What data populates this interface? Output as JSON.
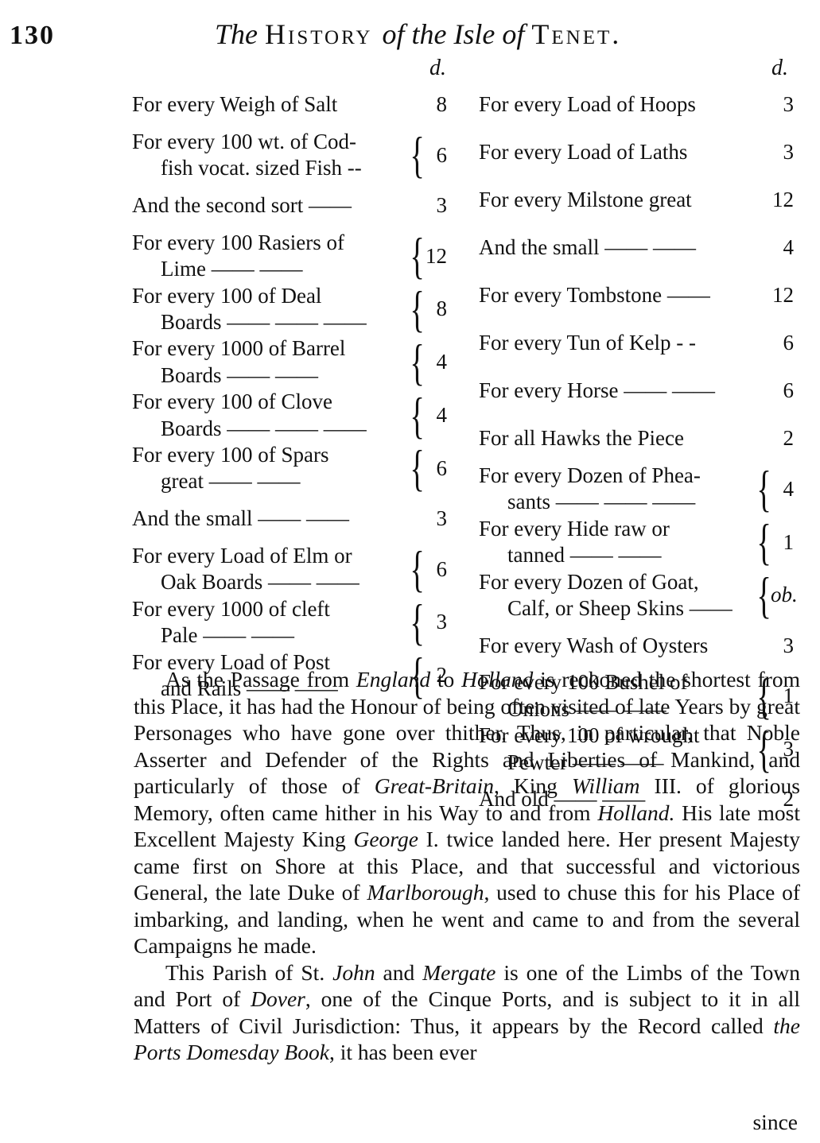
{
  "header": {
    "page_number": "130",
    "title_parts": [
      {
        "text": "The ",
        "style": "it"
      },
      {
        "text": "History ",
        "style": "sc"
      },
      {
        "text": "of the Isle of ",
        "style": "it"
      },
      {
        "text": "Tenet.",
        "style": "sc"
      }
    ]
  },
  "table": {
    "column_unit": "d.",
    "left": [
      {
        "lines": [
          "For every Weigh of Salt"
        ],
        "value": "8"
      },
      {
        "lines": [
          "For every 100 wt. of Cod-",
          "fish vocat. sized Fish --"
        ],
        "value": "6"
      },
      {
        "lines": [
          "And the second sort ——"
        ],
        "value": "3"
      },
      {
        "lines": [
          "For every 100 Rasiers of",
          "Lime —— ——"
        ],
        "value": "12"
      },
      {
        "lines": [
          "For every 100 of Deal",
          "Boards —— —— ——"
        ],
        "value": "8"
      },
      {
        "lines": [
          "For every 1000 of Barrel",
          "Boards —— ——"
        ],
        "value": "4"
      },
      {
        "lines": [
          "For every 100 of Clove",
          "Boards —— —— ——"
        ],
        "value": "4"
      },
      {
        "lines": [
          "For every 100 of Spars",
          "great —— ——"
        ],
        "value": "6"
      },
      {
        "lines": [
          "And the small —— ——"
        ],
        "value": "3"
      },
      {
        "lines": [
          "For every Load of Elm or",
          "Oak Boards —— ——"
        ],
        "value": "6"
      },
      {
        "lines": [
          "For every 1000 of cleft",
          "Pale —— ——"
        ],
        "value": "3"
      },
      {
        "lines": [
          "For every Load of Post",
          "and Rails —— ——"
        ],
        "value": "2"
      }
    ],
    "right": [
      {
        "lines": [
          "For every Load of Hoops"
        ],
        "value": "3"
      },
      {
        "lines": [
          "For every Load of Laths"
        ],
        "value": "3"
      },
      {
        "lines": [
          "For every Milstone great"
        ],
        "value": "12"
      },
      {
        "lines": [
          "And the small —— ——"
        ],
        "value": "4"
      },
      {
        "lines": [
          "For every Tombstone ——"
        ],
        "value": "12"
      },
      {
        "lines": [
          "For every Tun of Kelp - -"
        ],
        "value": "6"
      },
      {
        "lines": [
          "For every Horse —— ——"
        ],
        "value": "6"
      },
      {
        "lines": [
          "For all Hawks the Piece"
        ],
        "value": "2"
      },
      {
        "lines": [
          "For every Dozen of Phea-",
          "sants —— —— ——"
        ],
        "value": "4"
      },
      {
        "lines": [
          "For every Hide raw or",
          "tanned —— ——"
        ],
        "value": "1"
      },
      {
        "lines": [
          "For every Dozen of Goat,",
          "Calf, or Sheep Skins ——"
        ],
        "value": "ob."
      },
      {
        "lines": [
          "For every Wash of Oysters"
        ],
        "value": "3"
      },
      {
        "lines": [
          "For every 100 Bushel of",
          "Onions —— ——"
        ],
        "value": "1"
      },
      {
        "lines": [
          "For every 100 of wrought",
          "Pewter —— ——"
        ],
        "value": "3"
      },
      {
        "lines": [
          "And old —— ——"
        ],
        "value": "2"
      }
    ]
  },
  "body": {
    "paragraphs": [
      [
        {
          "t": "As the Passage from "
        },
        {
          "t": "England",
          "i": true
        },
        {
          "t": " to "
        },
        {
          "t": "Holland",
          "i": true
        },
        {
          "t": " is reckoned the shortest from this Place, it has had the Honour of being often visited of late Years by great Personages who have gone over thither. Thus, in particular, that Noble Asserter and Defender of the Rights and Liberties of Mankind, and particularly of those of "
        },
        {
          "t": "Great-Britain",
          "i": true
        },
        {
          "t": ", King "
        },
        {
          "t": "William",
          "i": true
        },
        {
          "t": " III. of glorious Memory, often came hither in his Way to and from "
        },
        {
          "t": "Holland.",
          "i": true
        },
        {
          "t": " His late most Excellent Majesty King "
        },
        {
          "t": "George",
          "i": true
        },
        {
          "t": " I. twice landed here. Her present Majesty came first on Shore at this Place, and that successful and victorious General, the late Duke of "
        },
        {
          "t": "Marlborough",
          "i": true
        },
        {
          "t": ", used to chuse this for his Place of imbarking, and landing, when he went and came to and from the several Campaigns he made."
        }
      ],
      [
        {
          "t": "This Parish of St. "
        },
        {
          "t": "John",
          "i": true
        },
        {
          "t": " and "
        },
        {
          "t": "Mergate",
          "i": true
        },
        {
          "t": " is one of the Limbs of the Town and Port of "
        },
        {
          "t": "Dover",
          "i": true
        },
        {
          "t": ", one of the Cinque Ports, and is subject to it in all Matters of Civil Jurisdiction: Thus, it appears by the Record called "
        },
        {
          "t": "the Ports Domesday Book",
          "i": true
        },
        {
          "t": ", it has been ever"
        }
      ]
    ],
    "catchword": "since"
  }
}
